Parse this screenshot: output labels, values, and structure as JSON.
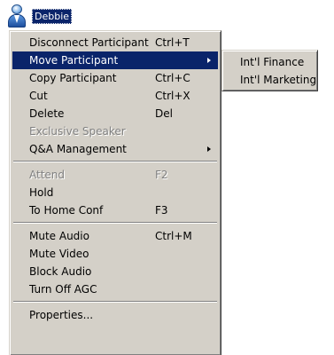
{
  "participant": {
    "name": "Debbie",
    "icon": "person-icon"
  },
  "context_menu": {
    "items": [
      {
        "label": "Disconnect Participant",
        "shortcut": "Ctrl+T"
      },
      {
        "label": "Move Participant",
        "shortcut": "",
        "submenu": true,
        "selected": true
      },
      {
        "label": "Copy Participant",
        "shortcut": "Ctrl+C"
      },
      {
        "label": "Cut",
        "shortcut": "Ctrl+X"
      },
      {
        "label": "Delete",
        "shortcut": "Del"
      },
      {
        "label": "Exclusive Speaker",
        "shortcut": "",
        "disabled": true
      },
      {
        "label": "Q&A Management",
        "shortcut": "",
        "submenu": true
      },
      {
        "separator": true
      },
      {
        "label": "Attend",
        "shortcut": "F2",
        "disabled": true
      },
      {
        "label": "Hold",
        "shortcut": ""
      },
      {
        "label": "To Home Conf",
        "shortcut": "F3"
      },
      {
        "separator": true
      },
      {
        "label": "Mute Audio",
        "shortcut": "Ctrl+M"
      },
      {
        "label": "Mute Video",
        "shortcut": ""
      },
      {
        "label": "Block Audio",
        "shortcut": ""
      },
      {
        "label": "Turn Off AGC",
        "shortcut": ""
      },
      {
        "separator": true
      },
      {
        "label": "Properties...",
        "shortcut": ""
      }
    ]
  },
  "submenu": {
    "items": [
      {
        "label": "Int'l Finance"
      },
      {
        "label": "Int'l Marketing"
      }
    ]
  },
  "colors": {
    "menu_background": "#d4d0c8",
    "highlight": "#0a246a",
    "highlight_text": "#ffffff",
    "disabled_text": "#808080"
  }
}
